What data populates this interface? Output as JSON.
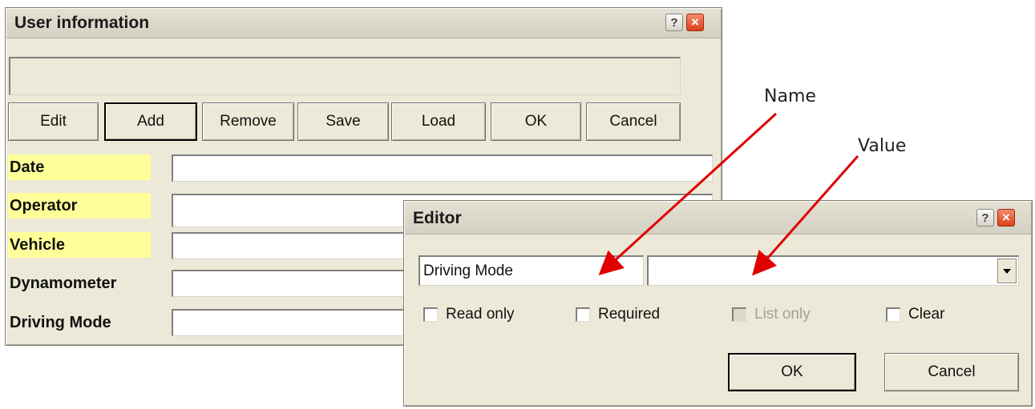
{
  "user_info": {
    "title": "User information",
    "help_label": "?",
    "close_label": "×",
    "status_text": "",
    "buttons": [
      "Edit",
      "Add",
      "Remove",
      "Save",
      "Load",
      "OK",
      "Cancel"
    ],
    "fields": [
      {
        "label": "Date",
        "value": "",
        "highlighted": true
      },
      {
        "label": "Operator",
        "value": "",
        "highlighted": true
      },
      {
        "label": "Vehicle",
        "value": "",
        "highlighted": true
      },
      {
        "label": "Dynamometer",
        "value": "",
        "highlighted": false
      },
      {
        "label": "Driving Mode",
        "value": "",
        "highlighted": false
      }
    ]
  },
  "editor": {
    "title": "Editor",
    "help_label": "?",
    "close_label": "×",
    "name_value": "Driving Mode",
    "value_value": "",
    "checkboxes": [
      {
        "label": "Read only",
        "checked": false,
        "enabled": true
      },
      {
        "label": "Required",
        "checked": false,
        "enabled": true
      },
      {
        "label": "List only",
        "checked": false,
        "enabled": false
      },
      {
        "label": "Clear",
        "checked": false,
        "enabled": true
      }
    ],
    "ok_label": "OK",
    "cancel_label": "Cancel"
  },
  "annotations": {
    "name_label": "Name",
    "value_label": "Value"
  },
  "colors": {
    "window_face": "#ece9d8",
    "highlight": "#ffff99",
    "arrow": "#e00000",
    "close_button": "#d9411a"
  }
}
